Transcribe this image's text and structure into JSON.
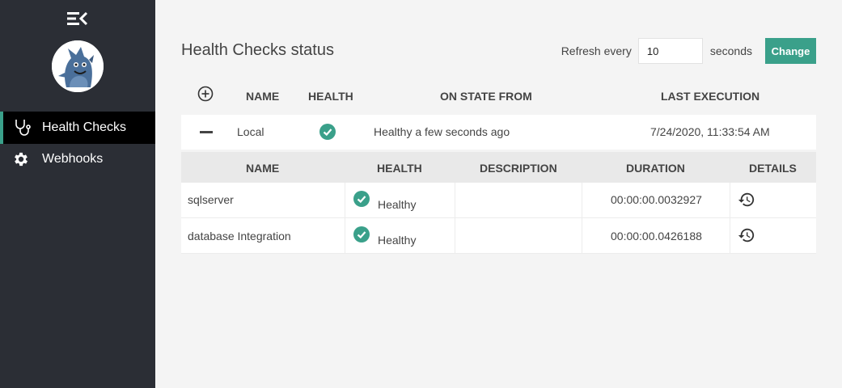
{
  "sidebar": {
    "items": [
      {
        "label": "Health Checks",
        "icon": "stethoscope-icon",
        "active": true
      },
      {
        "label": "Webhooks",
        "icon": "gear-icon",
        "active": false
      }
    ]
  },
  "header": {
    "title": "Health Checks status",
    "refresh_label": "Refresh every",
    "refresh_value": "10",
    "seconds_label": "seconds",
    "change_label": "Change"
  },
  "outer_table": {
    "columns": [
      "NAME",
      "HEALTH",
      "ON STATE FROM",
      "LAST EXECUTION"
    ],
    "rows": [
      {
        "name": "Local",
        "health": "healthy",
        "on_state_from": "Healthy a few seconds ago",
        "last_execution": "7/24/2020, 11:33:54 AM"
      }
    ]
  },
  "inner_table": {
    "columns": [
      "NAME",
      "HEALTH",
      "DESCRIPTION",
      "DURATION",
      "DETAILS"
    ],
    "rows": [
      {
        "name": "sqlserver",
        "health": "Healthy",
        "description": "",
        "duration": "00:00:00.0032927"
      },
      {
        "name": "database Integration",
        "health": "Healthy",
        "description": "",
        "duration": "00:00:00.0426188"
      }
    ]
  },
  "colors": {
    "accent": "#3aa08a",
    "sidebar_bg": "#2b2e35",
    "active_bg": "#000000"
  }
}
